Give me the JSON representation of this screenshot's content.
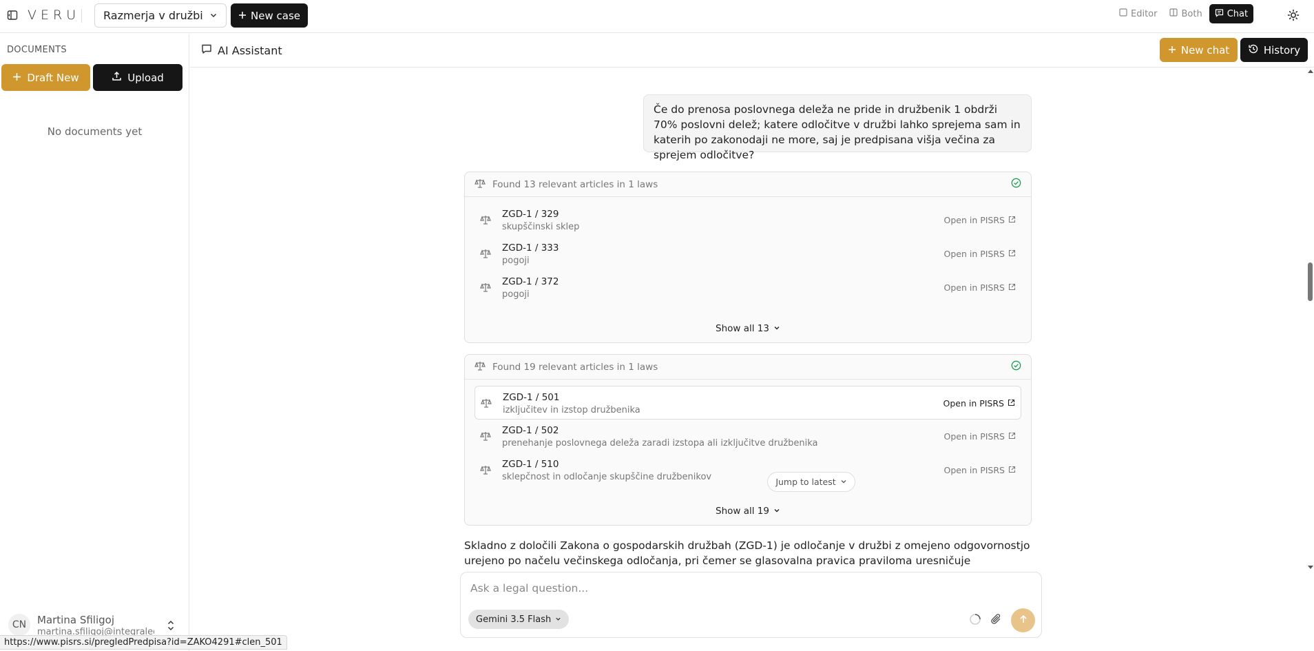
{
  "topbar": {
    "logo": "VERU",
    "case_name": "Razmerja v družbi",
    "new_case_label": "New case",
    "view_modes": [
      {
        "label": "Editor",
        "active": false
      },
      {
        "label": "Both",
        "active": false
      },
      {
        "label": "Chat",
        "active": true
      }
    ]
  },
  "sidebar": {
    "heading": "DOCUMENTS",
    "draft_label": "Draft New",
    "upload_label": "Upload",
    "empty_text": "No documents yet",
    "user": {
      "initials": "CN",
      "name": "Martina Sfiligoj",
      "email": "martina.sfiligoj@integraleg"
    }
  },
  "main": {
    "title": "AI Assistant",
    "new_chat_label": "New chat",
    "history_label": "History"
  },
  "chat": {
    "user_message": "Če do prenosa poslovnega deleža ne pride in družbenik 1 obdrži 70% poslovni delež; katere odločitve v družbi lahko sprejema sam in katerih po zakonodaji ne more, saj je predpisana višja večina za sprejem odločitve?",
    "open_label": "Open in PISRS",
    "search_results": [
      {
        "summary": "Found 13 relevant articles in 1 laws",
        "show_all": "Show all 13",
        "articles": [
          {
            "title": "ZGD-1 / 329",
            "subtitle": "skupščinski sklep"
          },
          {
            "title": "ZGD-1 / 333",
            "subtitle": "pogoji"
          },
          {
            "title": "ZGD-1 / 372",
            "subtitle": "pogoji"
          }
        ]
      },
      {
        "summary": "Found 19 relevant articles in 1 laws",
        "show_all": "Show all 19",
        "articles": [
          {
            "title": "ZGD-1 / 501",
            "subtitle": "izključitev in izstop družbenika"
          },
          {
            "title": "ZGD-1 / 502",
            "subtitle": "prenehanje poslovnega deleža zaradi izstopa ali izključitve družbenika"
          },
          {
            "title": "ZGD-1 / 510",
            "subtitle": "sklepčnost in odločanje skupščine družbenikov"
          }
        ]
      }
    ],
    "answer_text": "Skladno z določili Zakona o gospodarskih družbah (ZGD-1) je odločanje v družbi z omejeno odgovornostjo urejeno po načelu večinskega odločanja, pri čemer se glasovalna pravica praviloma uresničuje sorazmerno z višino",
    "jump_label": "Jump to latest"
  },
  "composer": {
    "placeholder": "Ask a legal question...",
    "model": "Gemini 3.5 Flash"
  },
  "statusbar": {
    "url": "https://www.pisrs.si/pregledPredpisa?id=ZAKO4291#clen_501"
  },
  "colors": {
    "accent": "#cf972e",
    "dark": "#161616",
    "success": "#1f9d55"
  }
}
